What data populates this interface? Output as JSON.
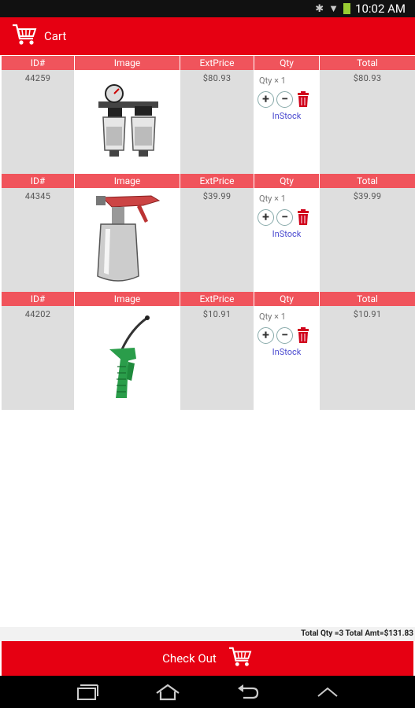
{
  "status_bar": {
    "time": "10:02 AM"
  },
  "app_bar": {
    "title": "Cart"
  },
  "headers": {
    "id": "ID#",
    "image": "Image",
    "ext_price": "ExtPrice",
    "qty": "Qty",
    "total": "Total"
  },
  "items": [
    {
      "id": "44259",
      "ext_price": "$80.93",
      "qty_label": "Qty",
      "qty_value": "× 1",
      "stock": "InStock",
      "total": "$80.93",
      "image_icon": "air-filter-regulator-image"
    },
    {
      "id": "44345",
      "ext_price": "$39.99",
      "qty_label": "Qty",
      "qty_value": "× 1",
      "stock": "InStock",
      "total": "$39.99",
      "image_icon": "spray-gun-image"
    },
    {
      "id": "44202",
      "ext_price": "$10.91",
      "qty_label": "Qty",
      "qty_value": "× 1",
      "stock": "InStock",
      "total": "$10.91",
      "image_icon": "blow-gun-image"
    }
  ],
  "summary": {
    "text": "Total Qty =3   Total Amt=$131.83"
  },
  "checkout": {
    "label": "Check Out"
  },
  "colors": {
    "brand_red": "#e60012",
    "header_red": "#f0545c",
    "cell_gray": "#dedede",
    "instock_blue": "#4a4ad0"
  }
}
